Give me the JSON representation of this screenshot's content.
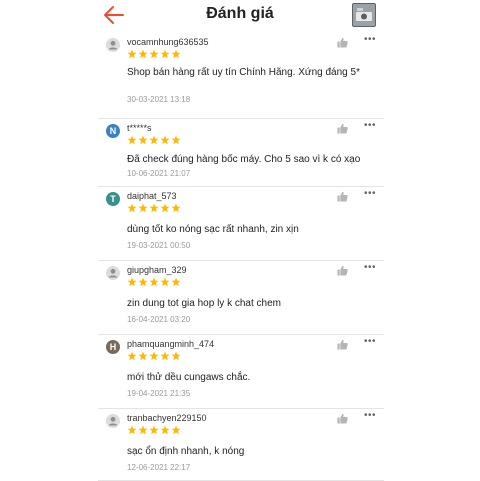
{
  "header": {
    "title": "Đánh giá",
    "back_icon": "back-arrow-icon",
    "accent_color": "#ee4d2d"
  },
  "star_color": "#ffb800",
  "reviews": [
    {
      "avatar_type": "default",
      "avatar_letter": "",
      "avatar_color": "#dcdcdc",
      "username": "vocamnhung636535",
      "rating": 5,
      "comment": "Shop bán hàng rất uy tín Chính Hãng. Xứng đáng 5*",
      "date": "30-03-2021 13:18"
    },
    {
      "avatar_type": "letter",
      "avatar_letter": "N",
      "avatar_color": "#3b82c4",
      "username": "t*****s",
      "rating": 5,
      "comment": "Đã check đúng hàng bốc máy. Cho 5 sao vì k có xạo",
      "date": "10-06-2021 21:07"
    },
    {
      "avatar_type": "letter",
      "avatar_letter": "T",
      "avatar_color": "#3a8f8f",
      "username": "daiphat_573",
      "rating": 5,
      "comment": "dùng tốt ko nóng sạc rất nhanh, zin xịn",
      "date": "19-03-2021 00:50"
    },
    {
      "avatar_type": "default",
      "avatar_letter": "",
      "avatar_color": "#dcdcdc",
      "username": "giupgham_329",
      "rating": 5,
      "comment": "zin dung tot gia hop ly k chat chem",
      "date": "16-04-2021 03:20"
    },
    {
      "avatar_type": "letter",
      "avatar_letter": "H",
      "avatar_color": "#7a6a5a",
      "username": "phamquangminh_474",
      "rating": 5,
      "comment": "mới thử dều cungaws chắc.",
      "date": "19-04-2021 21:35"
    },
    {
      "avatar_type": "default",
      "avatar_letter": "",
      "avatar_color": "#dcdcdc",
      "username": "tranbachyen229150",
      "rating": 5,
      "comment": "sạc ổn định nhanh, k nóng",
      "date": "12-06-2021 22:17"
    }
  ]
}
